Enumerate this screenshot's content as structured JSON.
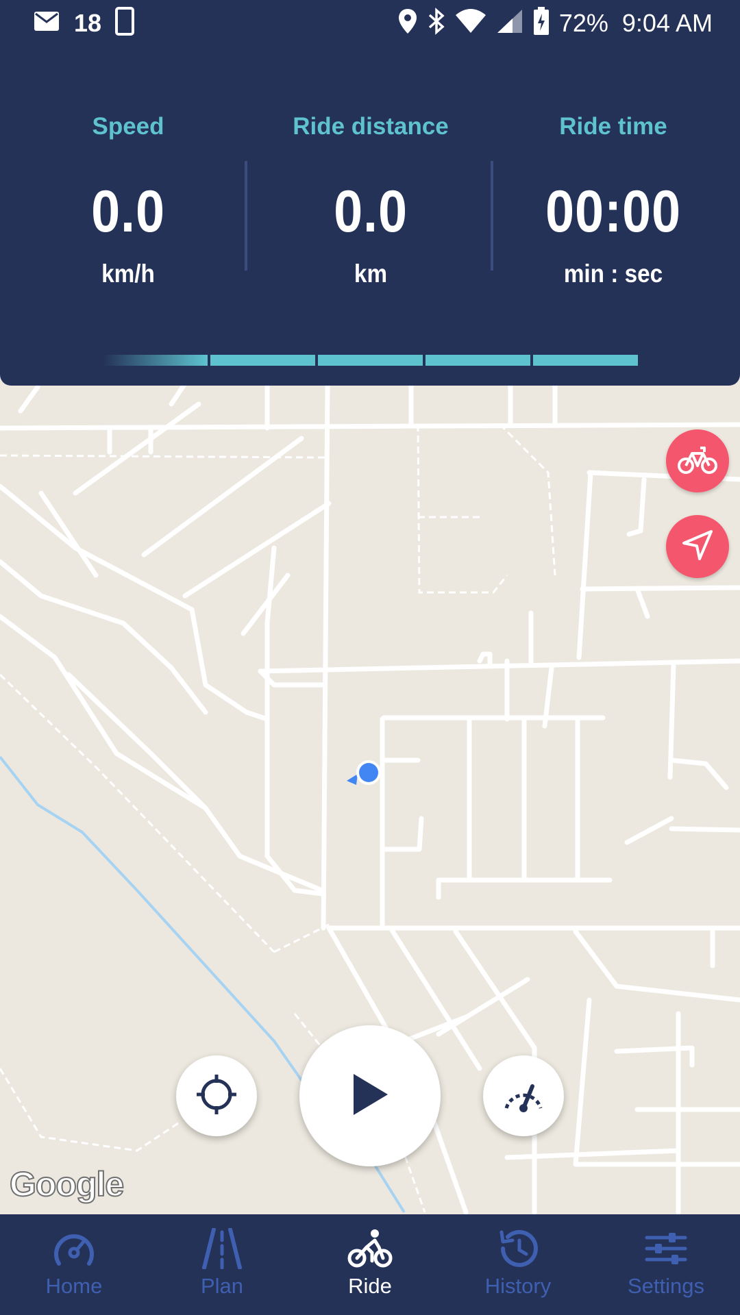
{
  "status_bar": {
    "notification_count": "18",
    "battery": "72%",
    "time": "9:04 AM",
    "icons": [
      "mail-icon",
      "phone-icon",
      "location-icon",
      "bluetooth-icon",
      "wifi-icon",
      "signal-icon",
      "battery-icon"
    ]
  },
  "stats": {
    "speed": {
      "label": "Speed",
      "value": "0.0",
      "unit": "km/h"
    },
    "distance": {
      "label": "Ride distance",
      "value": "0.0",
      "unit": "km"
    },
    "time": {
      "label": "Ride time",
      "value": "00:00",
      "unit": "min : sec"
    }
  },
  "map": {
    "attribution": "Google",
    "user_location": "blue-dot"
  },
  "floating_buttons": {
    "bike_mode": "bike-icon",
    "navigate": "navigation-arrow-icon",
    "locate": "crosshair-icon",
    "play": "play-icon",
    "speedometer": "speedometer-icon"
  },
  "bottom_nav": {
    "items": [
      {
        "label": "Home",
        "icon": "gauge-icon",
        "active": false
      },
      {
        "label": "Plan",
        "icon": "road-icon",
        "active": false
      },
      {
        "label": "Ride",
        "icon": "bike-icon",
        "active": true
      },
      {
        "label": "History",
        "icon": "history-icon",
        "active": false
      },
      {
        "label": "Settings",
        "icon": "sliders-icon",
        "active": false
      }
    ]
  },
  "colors": {
    "panel": "#253258",
    "accent": "#5ec3cf",
    "fab": "#f4566d",
    "nav_inactive": "#3f5fb0"
  }
}
